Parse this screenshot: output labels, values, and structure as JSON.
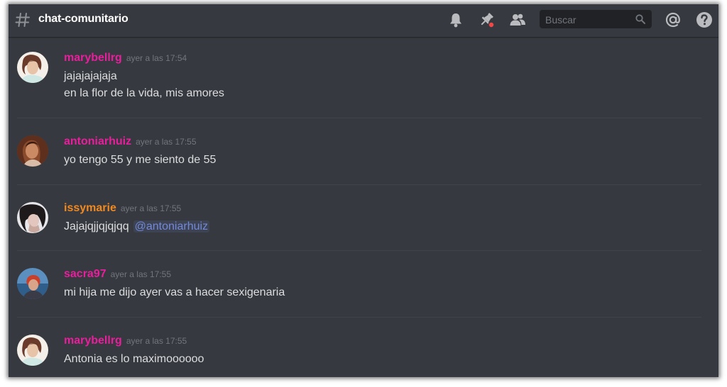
{
  "header": {
    "channel_name": "chat-comunitario",
    "icons": [
      "hashtag-icon",
      "bell-icon",
      "pin-icon",
      "members-icon",
      "search-icon",
      "at-icon",
      "help-icon"
    ],
    "search_placeholder": "Buscar"
  },
  "colors": {
    "background": "#36393f",
    "header_text": "#ffffff",
    "message_text": "#dcddde",
    "timestamp": "#72767d",
    "username_pink": "#e91e9c",
    "username_orange": "#f0891f",
    "mention": "#7289da",
    "pin_badge": "#f04747"
  },
  "messages": [
    {
      "username": "marybellrg",
      "timestamp": "ayer a las 17:54",
      "color": "#e91e9c",
      "lines": [
        "jajajajajaja",
        "en la flor de la vida, mis amores"
      ]
    },
    {
      "username": "antoniarhuiz",
      "timestamp": "ayer a las 17:55",
      "color": "#e91e9c",
      "lines": [
        "yo tengo 55 y me siento de 55"
      ]
    },
    {
      "username": "issymarie",
      "timestamp": "ayer a las 17:55",
      "color": "#f0891f",
      "lines": [
        "Jajajqjjqjqjqq"
      ],
      "mention": "@antoniarhuiz"
    },
    {
      "username": "sacra97",
      "timestamp": "ayer a las 17:55",
      "color": "#e91e9c",
      "lines": [
        "mi hija me dijo ayer vas a hacer sexigenaria"
      ]
    },
    {
      "username": "marybellrg",
      "timestamp": "ayer a las 17:55",
      "color": "#e91e9c",
      "lines": [
        "Antonia es lo maximoooooo"
      ]
    }
  ]
}
